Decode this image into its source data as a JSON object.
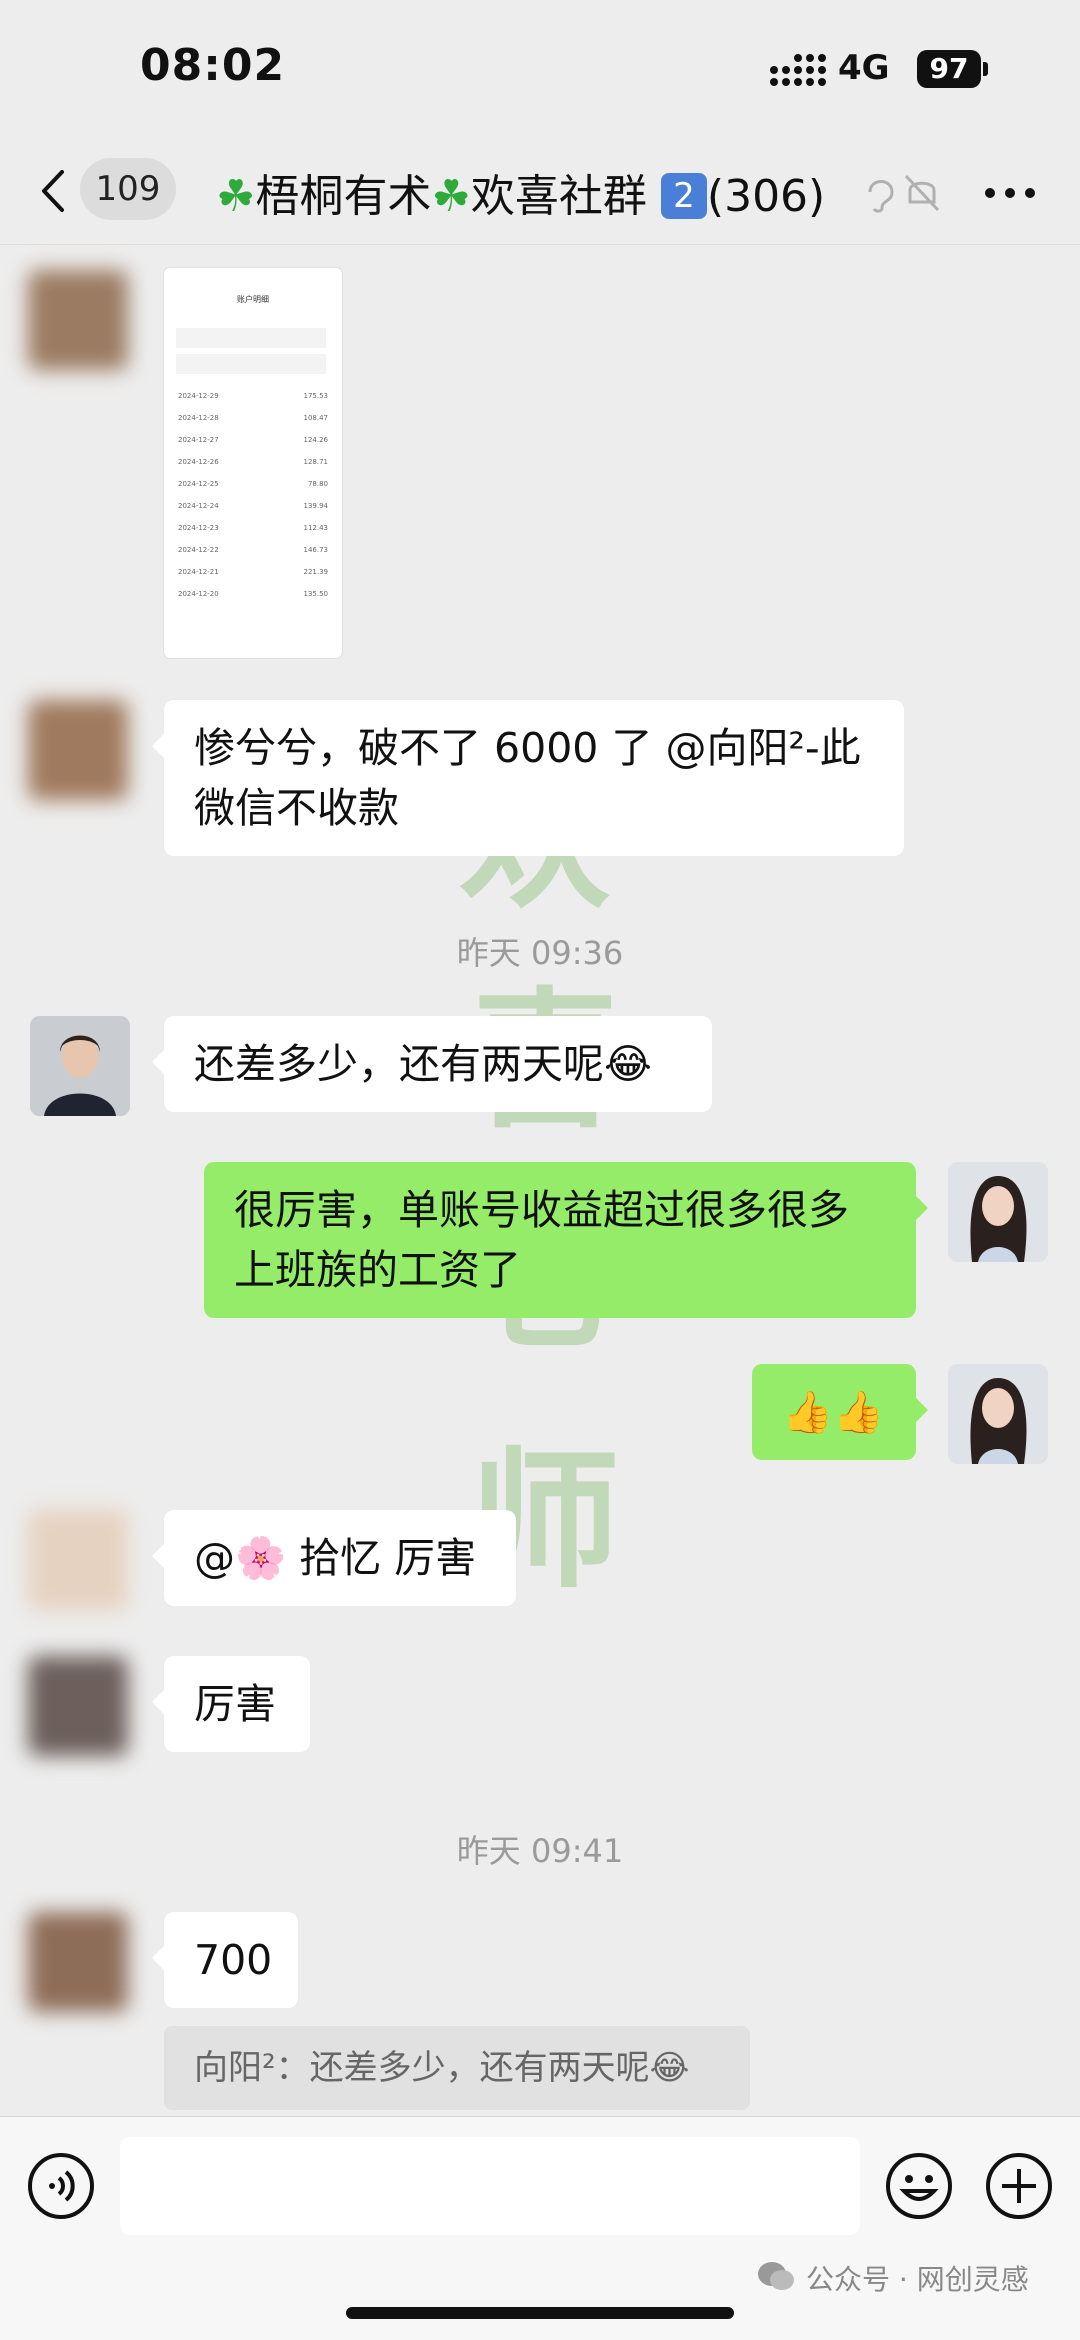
{
  "status_bar": {
    "time": "08:02",
    "network": "4G",
    "battery": "97"
  },
  "nav": {
    "unread_badge": "109",
    "title_part1": "梧桐有术",
    "title_part2": "欢喜社群",
    "title_num": "2",
    "member_count": "(306)",
    "icons": [
      "back-chevron-icon",
      "earpiece-icon",
      "mute-bell-icon",
      "more-icon"
    ]
  },
  "thumbnail": {
    "title": "账户明细",
    "rows": [
      {
        "date": "2024-12-29",
        "value": "175.53"
      },
      {
        "date": "2024-12-28",
        "value": "108.47"
      },
      {
        "date": "2024-12-27",
        "value": "124.26"
      },
      {
        "date": "2024-12-26",
        "value": "128.71"
      },
      {
        "date": "2024-12-25",
        "value": "78.80"
      },
      {
        "date": "2024-12-24",
        "value": "139.94"
      },
      {
        "date": "2024-12-23",
        "value": "112.43"
      },
      {
        "date": "2024-12-22",
        "value": "146.73"
      },
      {
        "date": "2024-12-21",
        "value": "221.39"
      },
      {
        "date": "2024-12-20",
        "value": "135.50"
      }
    ]
  },
  "messages": {
    "m1": "惨兮兮，破不了 6000 了 @向阳²-此微信不收款",
    "ts1": "昨天 09:36",
    "m2": "还差多少，还有两天呢😂",
    "m3": "很厉害，单账号收益超过很多很多上班族的工资了",
    "m4": "👍👍",
    "m5": "@🌸 拾忆 厉害",
    "m6": "厉害",
    "ts2": "昨天 09:41",
    "m7": "700",
    "quote": "向阳²：还差多少，还有两天呢😂"
  },
  "watermark": [
    "欢",
    "喜",
    "老",
    "师"
  ],
  "credit": "公众号 · 网创灵感",
  "colors": {
    "bubble_green": "#95ec69",
    "background": "#ededed"
  }
}
